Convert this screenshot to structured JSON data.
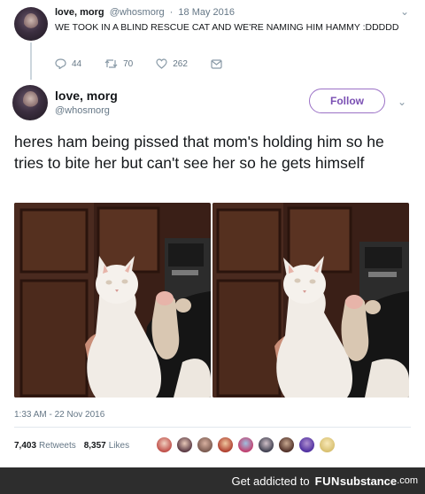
{
  "tweet_1": {
    "name": "love, morg",
    "handle": "@whosmorg",
    "separator": "·",
    "date": "18 May 2016",
    "text": "WE TOOK IN A BLIND RESCUE CAT AND WE'RE NAMING HIM HAMMY :DDDDD",
    "replies": "44",
    "retweets": "70",
    "likes": "262",
    "icons": [
      "reply-icon",
      "retweet-icon",
      "like-icon",
      "dm-icon",
      "chevron-down-icon"
    ]
  },
  "tweet_2": {
    "name": "love, morg",
    "handle": "@whosmorg",
    "follow_label": "Follow",
    "text": "heres ham being pissed that mom's holding him so he tries to bite her but can't see her so he gets himself",
    "timestamp": "1:33 AM - 22 Nov 2016",
    "retweets_count": "7,403",
    "retweets_label": "Retweets",
    "likes_count": "8,357",
    "likes_label": "Likes",
    "accent_color": "#9b71c6"
  },
  "watermark": {
    "cta": "Get addicted to",
    "brand_fun": "FUN",
    "brand_sub": "substance",
    "brand_domain": ".com"
  }
}
